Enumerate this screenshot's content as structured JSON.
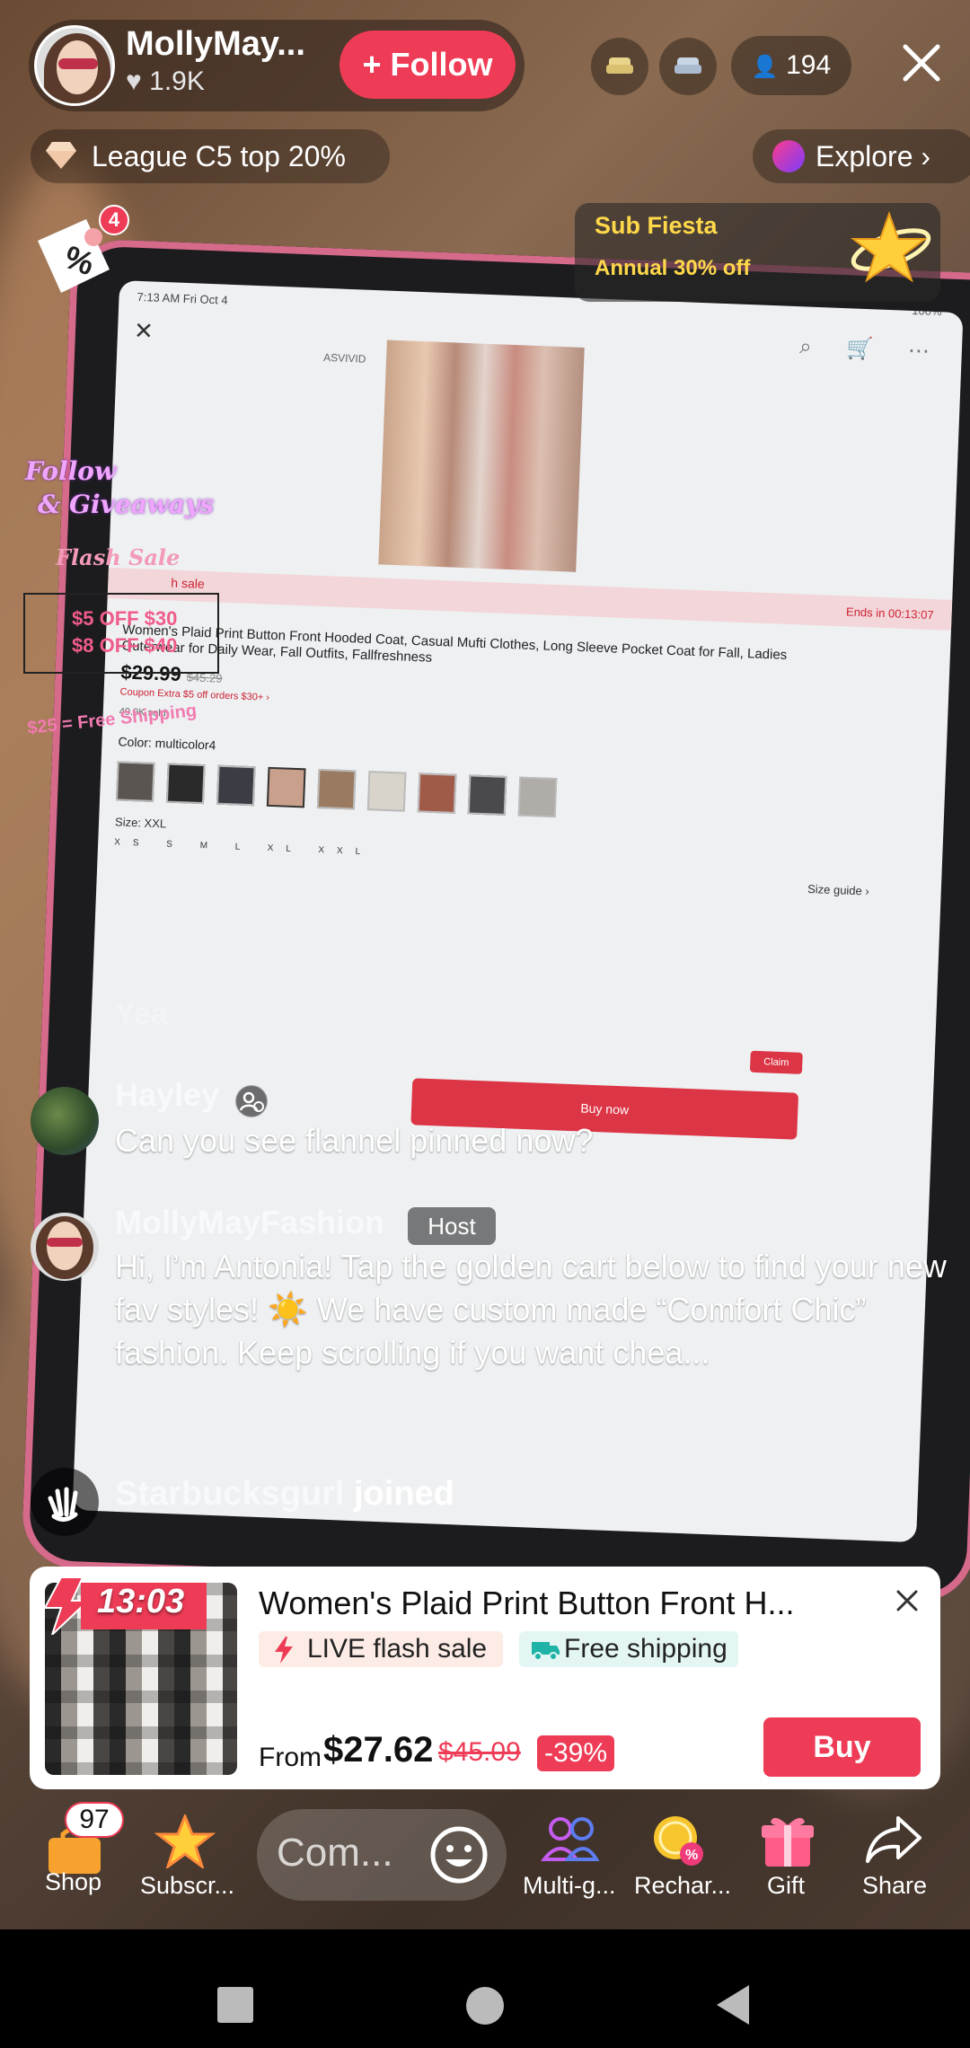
{
  "host": {
    "name": "MollyMay...",
    "likes": "1.9K",
    "follow_label": "+ Follow",
    "viewer_count": "194"
  },
  "league": {
    "label": "League C5 top 20%"
  },
  "explore": {
    "label": "Explore"
  },
  "discount": {
    "badge_count": "4"
  },
  "subscription_promo": {
    "title": "Sub Fiesta",
    "subtitle": "Annual 30% off"
  },
  "tablet_screen": {
    "status_time": "7:13 AM  Fri Oct 4",
    "battery": "100%",
    "brand": "ASVIVID",
    "flash_label": "h sale",
    "ends_in": "Ends in 00:13:07",
    "product_title": "Women's Plaid Print Button Front Hooded Coat, Casual Mufti Clothes, Long Sleeve Pocket Coat for Fall, Ladies Outerwear for Daily Wear, Fall Outfits, Fallfreshness",
    "price": "$29.99",
    "old_price": "$45.29",
    "coupon": "Coupon  Extra $5 off orders $30+ ›",
    "sold": "49.9K sold",
    "color": "Color: multicolor4",
    "size": "Size: XXL",
    "sizes": "XS S M L XL XXL",
    "size_guide": "Size guide ›",
    "claim": "Claim",
    "buy_now": "Buy now"
  },
  "stickers": {
    "line1": "Follow",
    "line2": "& Giveaways",
    "line3": "Flash Sale",
    "line4": "$5 OFF $30",
    "line5": "$8 OFF $40",
    "line6": "$25 = Free Shipping"
  },
  "chat": {
    "faded_text": "Yea",
    "messages": [
      {
        "user": "Hayley",
        "text": "Can you see flannel pinned now?"
      },
      {
        "user": "MollyMayFashion",
        "tag": "Host",
        "text": "Hi, I’m Antonia! Tap the golden cart below to find your new fav styles! ☀️ We have custom made “Comfort Chic” fashion. Keep scrolling if you want chea..."
      }
    ],
    "join": {
      "user": "Starbucksgurl",
      "action": "joined"
    }
  },
  "product_card": {
    "timer": "13:03",
    "title": "Women's Plaid Print Button Front H...",
    "flash_badge": "LIVE flash sale",
    "shipping_badge": "Free shipping",
    "price_prefix": "From",
    "price": "$27.62",
    "original_price": "$45.09",
    "discount": "-39%",
    "buy_label": "Buy"
  },
  "toolbar": {
    "shop_label": "Shop",
    "shop_badge": "97",
    "subscribe_label": "Subscr...",
    "comment_placeholder": "Com...",
    "multi_guest_label": "Multi-g...",
    "recharge_label": "Rechar...",
    "gift_label": "Gift",
    "share_label": "Share"
  },
  "colors": {
    "accent_red": "#ee3b56",
    "promo_yellow": "#ffd84a"
  }
}
